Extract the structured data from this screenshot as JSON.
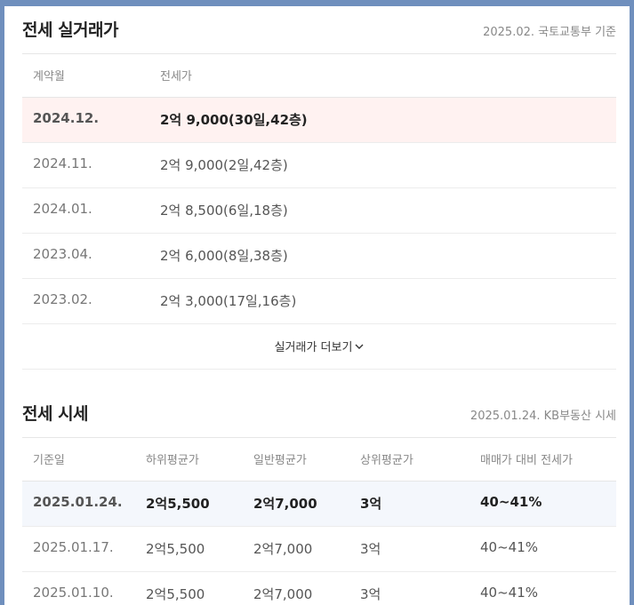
{
  "rent_history": {
    "title": "전세 실거래가",
    "source": "2025.02. 국토교통부 기준",
    "headers": [
      "계약월",
      "전세가"
    ],
    "rows": [
      {
        "month": "2024.12.",
        "price": "2억 9,000(30일,42층)"
      },
      {
        "month": "2024.11.",
        "price": "2억 9,000(2일,42층)"
      },
      {
        "month": "2024.01.",
        "price": "2억 8,500(6일,18층)"
      },
      {
        "month": "2023.04.",
        "price": "2억 6,000(8일,38층)"
      },
      {
        "month": "2023.02.",
        "price": "2억 3,000(17일,16층)"
      }
    ],
    "more_label": "실거래가 더보기",
    "more_icon": "chevron-down-icon"
  },
  "market_price": {
    "title": "전세 시세",
    "source": "2025.01.24. KB부동산 시세",
    "headers": [
      "기준일",
      "하위평균가",
      "일반평균가",
      "상위평균가",
      "매매가 대비 전세가"
    ],
    "rows": [
      {
        "date": "2025.01.24.",
        "low": "2억5,500",
        "avg": "2억7,000",
        "high": "3억",
        "ratio": "40~41%"
      },
      {
        "date": "2025.01.17.",
        "low": "2억5,500",
        "avg": "2억7,000",
        "high": "3억",
        "ratio": "40~41%"
      },
      {
        "date": "2025.01.10.",
        "low": "2억5,500",
        "avg": "2억7,000",
        "high": "3억",
        "ratio": "40~41%"
      }
    ]
  },
  "colors": {
    "frame_background": "#6f8fbd",
    "highlight_rent_row": "#fff2f1",
    "highlight_market_row": "#f4f7fc"
  }
}
